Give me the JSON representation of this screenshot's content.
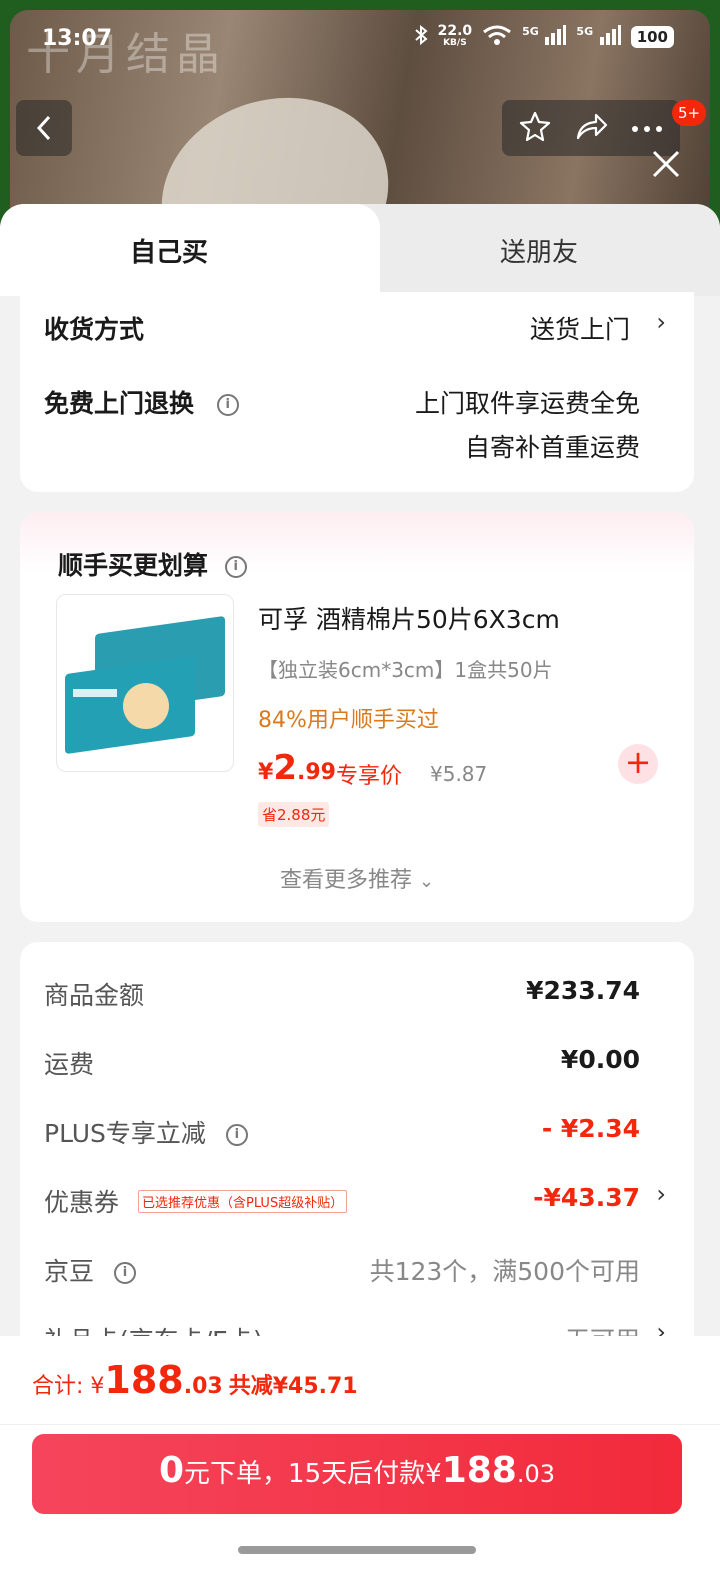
{
  "status_bar": {
    "time": "13:07",
    "net_speed": "22.0",
    "net_unit": "KB/S",
    "signal1": "5G",
    "signal2": "5G",
    "battery": "100"
  },
  "header": {
    "brand_watermark": "十月结晶",
    "notification_badge": "5+"
  },
  "tabs": {
    "self": "自己买",
    "gift": "送朋友"
  },
  "delivery": {
    "label": "收货方式",
    "value": "送货上门"
  },
  "free_return": {
    "label": "免费上门退换",
    "line1": "上门取件享运费全免",
    "line2": "自寄补首重运费"
  },
  "addon": {
    "title": "顺手买更划算",
    "product_name": "可孚 酒精棉片50片6X3cm",
    "spec": "【独立装6cm*3cm】1盒共50片",
    "tag": "84%用户顺手买过",
    "price_yen": "¥",
    "price_int": "2",
    "price_dec": ".99",
    "price_label": "专享价",
    "orig_price": "¥5.87",
    "save": "省2.88元",
    "more": "查看更多推荐"
  },
  "summary": {
    "goods_label": "商品金额",
    "goods_value": "¥233.74",
    "shipping_label": "运费",
    "shipping_value": "¥0.00",
    "plus_label": "PLUS专享立减",
    "plus_value": "- ¥2.34",
    "coupon_label": "优惠券",
    "coupon_tag": "已选推荐优惠（含PLUS超级补贴）",
    "coupon_value": "-¥43.37",
    "jingdou_label": "京豆",
    "jingdou_value": "共123个，满500个可用",
    "giftcard_label": "礼品卡(京东卡/E卡)",
    "giftcard_value": "无可用"
  },
  "footer": {
    "total_label": "合计: ",
    "total_yen": "¥",
    "total_int": "188",
    "total_dec": ".03",
    "total_save": "共减¥45.71",
    "btn_zero": "0",
    "btn_text1": "元下单，15天后付款¥",
    "btn_int": "188",
    "btn_dec": ".03"
  },
  "colors": {
    "accent": "#f2270c",
    "tag_orange": "#d97a1e"
  }
}
